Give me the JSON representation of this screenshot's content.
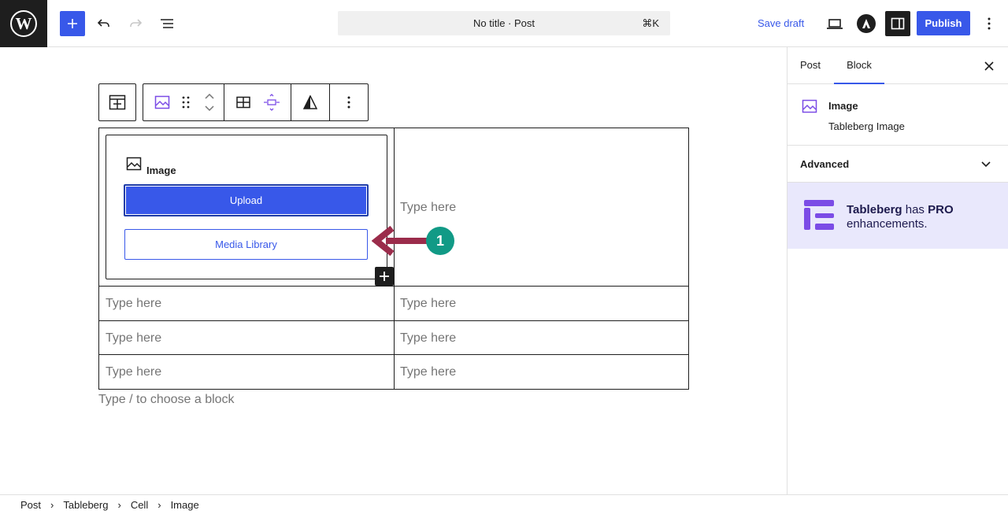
{
  "header": {
    "title": "No title · Post",
    "shortcut": "⌘K",
    "save_draft": "Save draft",
    "publish": "Publish"
  },
  "table": {
    "image_block": {
      "label": "Image",
      "upload": "Upload",
      "media_library": "Media Library"
    },
    "cells": [
      "Type here",
      "Type here",
      "Type here",
      "Type here",
      "Type here",
      "Type here",
      "Type here"
    ]
  },
  "annotation": {
    "number": "1"
  },
  "appender_placeholder": "Type / to choose a block",
  "sidebar": {
    "tabs": [
      "Post",
      "Block"
    ],
    "active_tab": "Block",
    "block_title": "Image",
    "block_description": "Tableberg Image",
    "advanced_label": "Advanced",
    "promo": {
      "brand": "Tableberg",
      "middle": "has",
      "pro": "PRO",
      "tail": "enhancements."
    }
  },
  "breadcrumbs": [
    "Post",
    "Tableberg",
    "Cell",
    "Image"
  ],
  "colors": {
    "accent": "#3858e9",
    "annotation_arrow": "#9b2c4b",
    "annotation_badge": "#119a86",
    "promo_bg": "#e9e8fc",
    "brand_purple": "#7b4ce6"
  }
}
